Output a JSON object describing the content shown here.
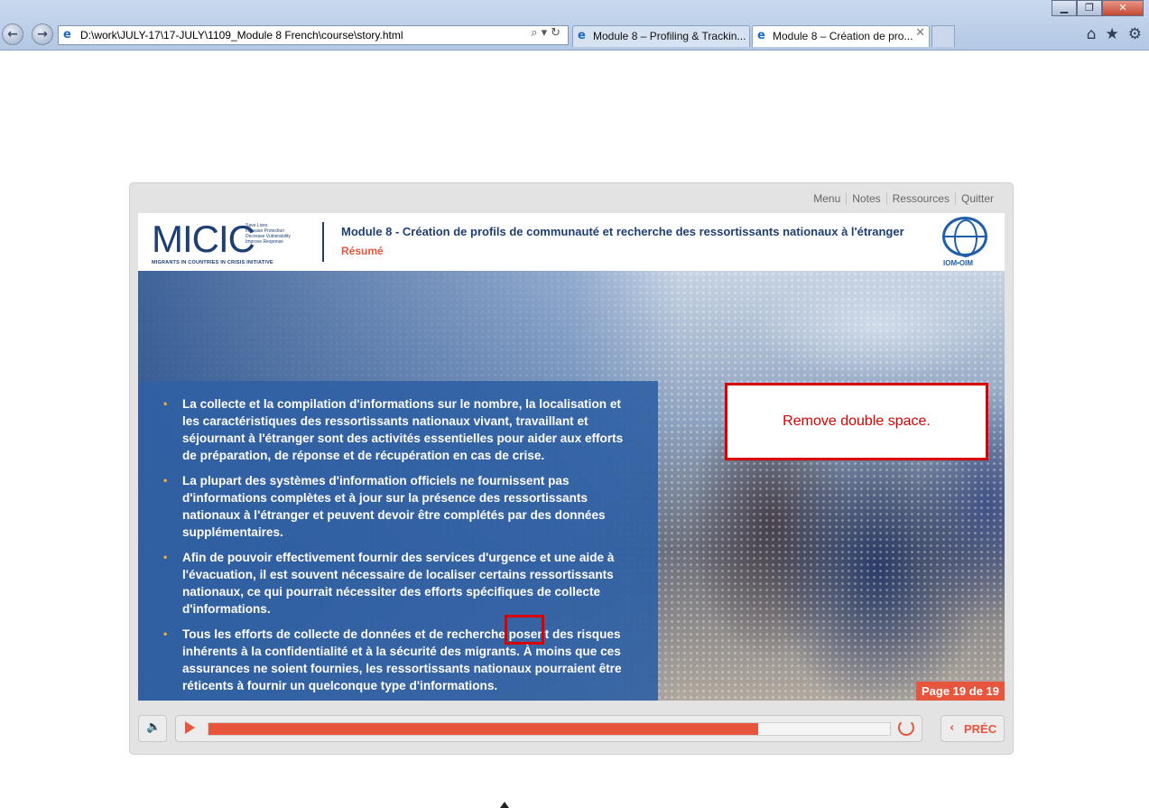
{
  "browser": {
    "address": "D:\\work\\JULY-17\\17-JULY\\1109_Module 8 French\\course\\story.html",
    "tabs": [
      {
        "label": "Module 8 – Profiling & Trackin..."
      },
      {
        "label": "Module 8 – Création de pro..."
      }
    ]
  },
  "player_menu": [
    "Menu",
    "Notes",
    "Ressources",
    "Quitter"
  ],
  "header": {
    "logo_text": "MICIC",
    "logo_taglines": [
      "Save Lives",
      "Increase Protection",
      "Decrease Vulnerability",
      "Improve Response"
    ],
    "logo_subtitle": "MIGRANTS IN COUNTRIES IN CRISIS INITIATIVE",
    "module_title": "Module 8 - Création de profils de communauté et recherche des ressortissants nationaux à l'étranger",
    "section_title": "Résumé",
    "iom_label": "IOM•OIM"
  },
  "bullets": [
    "La collecte et la compilation d'informations sur le nombre, la localisation et les caractéristiques des ressortissants nationaux vivant, travaillant et séjournant à l'étranger sont des activités essentielles pour aider aux efforts de préparation, de réponse et de récupération en cas de crise.",
    "La plupart des systèmes d'information officiels ne fournissent pas d'informations complètes et à jour sur la présence des ressortissants nationaux à l'étranger et peuvent devoir être complétés par des données supplémentaires.",
    "Afin de pouvoir effectivement fournir des services d'urgence et une aide à l'évacuation, il est souvent nécessaire de localiser certains ressortissants nationaux, ce qui pourrait nécessiter des efforts spécifiques de collecte d'informations.",
    "Tous les efforts de collecte de données et de recherche  posent des risques inhérents à la confidentialité et à la sécurité des migrants. À moins que ces assurances ne soient fournies, les ressortissants nationaux pourraient être réticents à fournir un quelconque type d'informations."
  ],
  "comment": "Remove double space.",
  "page_indicator": "Page 19 de 19",
  "progress_percent": 80.7,
  "prev_label": "PRÉC",
  "colors": {
    "accent": "#e8553d",
    "brand_blue": "#1f3f74",
    "comment_red": "#d90000"
  }
}
